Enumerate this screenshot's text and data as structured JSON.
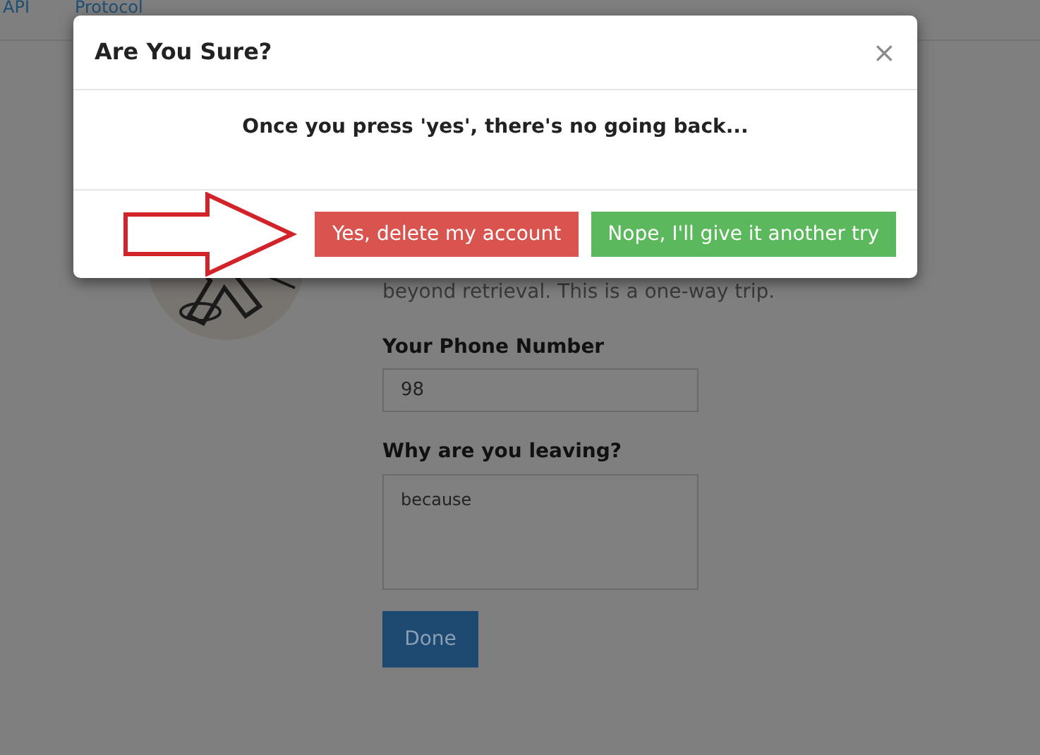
{
  "nav": {
    "links": [
      "API",
      "Protocol"
    ]
  },
  "form": {
    "notice": "beyond retrieval. This is a one-way trip.",
    "phone_label": "Your Phone Number",
    "phone_value": "98",
    "reason_label": "Why are you leaving?",
    "reason_value": "because",
    "submit": "Done"
  },
  "modal": {
    "title": "Are You Sure?",
    "close": "×",
    "message": "Once you press 'yes', there's no going back...",
    "buttons": [
      {
        "label": "Yes, delete my account",
        "kind": "danger"
      },
      {
        "label": "Nope, I'll give it another try",
        "kind": "success"
      }
    ]
  }
}
